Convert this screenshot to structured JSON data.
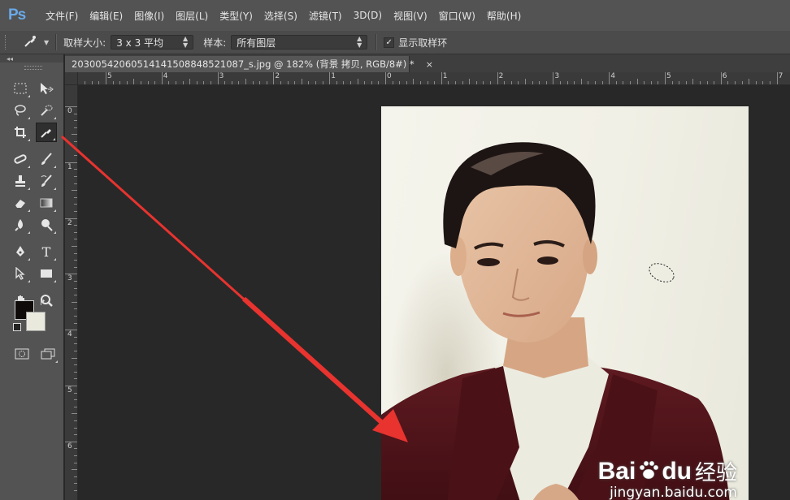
{
  "app": {
    "logo": "Ps"
  },
  "menu": [
    "文件(F)",
    "编辑(E)",
    "图像(I)",
    "图层(L)",
    "类型(Y)",
    "选择(S)",
    "滤镜(T)",
    "3D(D)",
    "视图(V)",
    "窗口(W)",
    "帮助(H)"
  ],
  "options": {
    "sample_size_label": "取样大小:",
    "sample_size_value": "3 x 3 平均",
    "sample_label": "样本:",
    "sample_value": "所有图层",
    "show_ring_label": "显示取样环",
    "show_ring_checked": true
  },
  "document": {
    "tab_title": "20300542060514141508848521087_s.jpg @ 182% (背景 拷贝, RGB/8#) *",
    "close": "×"
  },
  "rulers": {
    "h_labels": [
      "5",
      "4",
      "3",
      "2",
      "1",
      "0",
      "1",
      "2",
      "3",
      "4",
      "5",
      "6",
      "7"
    ],
    "v_labels": [
      "0",
      "1",
      "2",
      "3",
      "4",
      "5",
      "6"
    ]
  },
  "toolbar": {
    "collapse": "◂◂",
    "foreground_color": "#100b0b",
    "background_color": "#e9e9dd"
  },
  "watermark": {
    "brand_a": "Bai",
    "brand_b": "du",
    "brand_cn": "经验",
    "url": "jingyan.baidu.com"
  },
  "colors": {
    "accent_arrow": "#e8332f",
    "ps_blue": "#6aa9e8"
  }
}
